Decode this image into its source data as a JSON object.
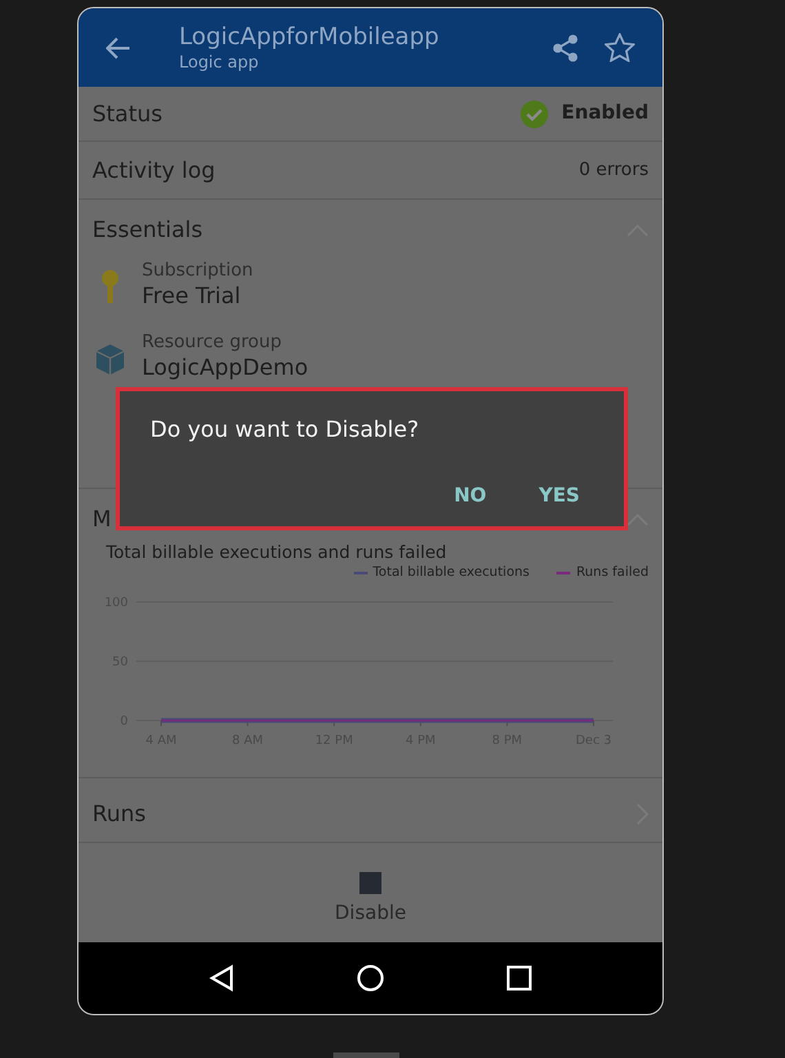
{
  "header": {
    "title": "LogicAppforMobileapp",
    "subtitle": "Logic app"
  },
  "status": {
    "label": "Status",
    "value": "Enabled",
    "enabled": true
  },
  "activity_log": {
    "label": "Activity log",
    "value": "0 errors"
  },
  "essentials": {
    "title": "Essentials",
    "expanded": true,
    "items": [
      {
        "kind": "key",
        "label": "Subscription",
        "value": "Free Trial"
      },
      {
        "kind": "cube",
        "label": "Resource group",
        "value": "LogicAppDemo"
      }
    ]
  },
  "monitoring": {
    "title": "M",
    "expanded": true,
    "chart_title": "Total billable executions and runs failed",
    "chart_data": {
      "type": "line",
      "categories": [
        "4 AM",
        "8 AM",
        "12 PM",
        "4 PM",
        "8 PM",
        "Dec 3"
      ],
      "yticks": [
        0,
        50,
        100
      ],
      "ylim": [
        0,
        100
      ],
      "series": [
        {
          "name": "Total billable executions",
          "color": "#4a4a78",
          "values": [
            0,
            0,
            0,
            0,
            0,
            0
          ]
        },
        {
          "name": "Runs failed",
          "color": "#7a2a7a",
          "values": [
            0,
            0,
            0,
            0,
            0,
            0
          ]
        }
      ]
    }
  },
  "runs": {
    "label": "Runs"
  },
  "bottom_action": {
    "label": "Disable"
  },
  "dialog": {
    "message": "Do you want to Disable?",
    "buttons": [
      "NO",
      "YES"
    ]
  }
}
